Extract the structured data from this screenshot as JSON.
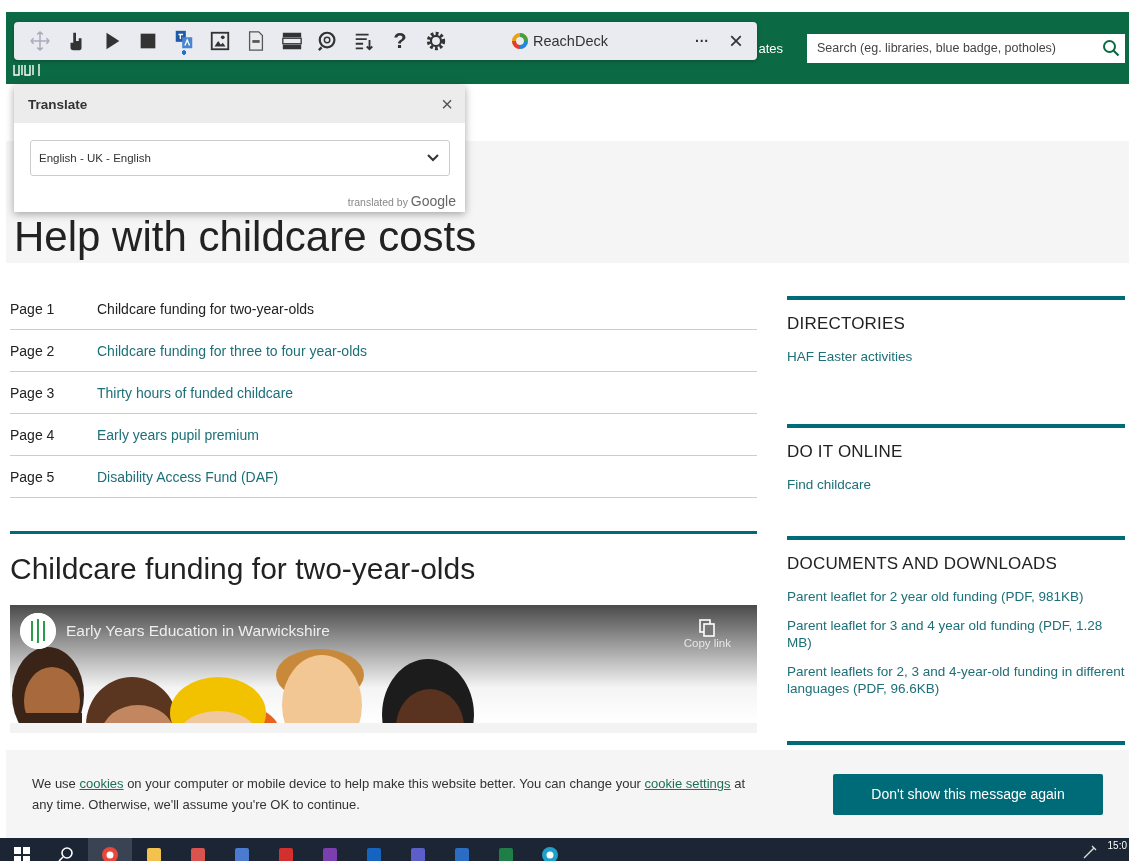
{
  "header": {
    "nav_fragment": "ates",
    "search": {
      "placeholder": "Search (eg. libraries, blue badge, potholes)"
    }
  },
  "reader_toolbar": {
    "tools": [
      {
        "kind": "move",
        "selected": false
      },
      {
        "kind": "hand",
        "selected": false
      },
      {
        "kind": "play",
        "selected": false
      },
      {
        "kind": "stop",
        "selected": false
      },
      {
        "kind": "translate",
        "selected": true
      },
      {
        "kind": "picture",
        "selected": false
      },
      {
        "kind": "mp3",
        "selected": false
      },
      {
        "kind": "mask",
        "selected": false
      },
      {
        "kind": "magnifier",
        "selected": false
      },
      {
        "kind": "list",
        "selected": false
      },
      {
        "kind": "help",
        "label": "?",
        "selected": false
      },
      {
        "kind": "gear",
        "selected": false
      }
    ],
    "brand": "ReachDeck",
    "more": "···",
    "close": "×"
  },
  "translate_panel": {
    "title": "Translate",
    "close": "×",
    "language": "English - UK - English",
    "credit_prefix": "translated by",
    "credit_brand": "Google"
  },
  "hero": {
    "title": "Help with childcare costs"
  },
  "pages": [
    {
      "number": "Page 1",
      "title": "Childcare funding for two-year-olds",
      "selected": true
    },
    {
      "number": "Page 2",
      "title": "Childcare funding for three to four year-olds",
      "selected": false
    },
    {
      "number": "Page 3",
      "title": "Thirty hours of funded childcare",
      "selected": false
    },
    {
      "number": "Page 4",
      "title": "Early years pupil premium",
      "selected": false
    },
    {
      "number": "Page 5",
      "title": "Disability Access Fund (DAF)",
      "selected": false
    }
  ],
  "section_heading": "Childcare funding for two-year-olds",
  "video": {
    "title": "Early Years Education in Warwickshire",
    "copy_link": "Copy link"
  },
  "sidebar": [
    {
      "heading": "DIRECTORIES",
      "links": [
        "HAF Easter activities"
      ]
    },
    {
      "heading": "DO IT ONLINE",
      "links": [
        "Find childcare"
      ]
    },
    {
      "heading": "DOCUMENTS AND DOWNLOADS",
      "links": [
        "Parent leaflet for 2 year old funding (PDF, 981KB)",
        "Parent leaflet for 3 and 4 year old funding (PDF, 1.28 MB)",
        "Parent leaflets for 2, 3 and 4-year-old funding in different languages (PDF, 96.6KB)"
      ]
    }
  ],
  "cookie_banner": {
    "parts": [
      {
        "kind": "text",
        "text": "We use "
      },
      {
        "kind": "link",
        "text": "cookies"
      },
      {
        "kind": "text",
        "text": " on your computer or mobile device to help make this website better. You can change your "
      },
      {
        "kind": "link",
        "text": "cookie settings"
      },
      {
        "kind": "text",
        "text": " at any time. Otherwise, we'll assume you're OK to continue."
      }
    ],
    "button": "Don't show this message again"
  },
  "taskbar": {
    "apps": [
      {
        "kind": "start",
        "selected": false
      },
      {
        "kind": "search",
        "selected": false
      },
      {
        "kind": "chrome",
        "selected": true
      },
      {
        "kind": "folder",
        "selected": false
      },
      {
        "kind": "paint",
        "selected": false
      },
      {
        "kind": "document",
        "selected": false
      },
      {
        "kind": "red-app",
        "selected": false
      },
      {
        "kind": "onenote",
        "selected": false
      },
      {
        "kind": "outlook",
        "selected": false
      },
      {
        "kind": "teams",
        "selected": false
      },
      {
        "kind": "word",
        "selected": false
      },
      {
        "kind": "excel",
        "selected": false
      },
      {
        "kind": "edge",
        "selected": false
      }
    ],
    "clock": "15:0"
  }
}
